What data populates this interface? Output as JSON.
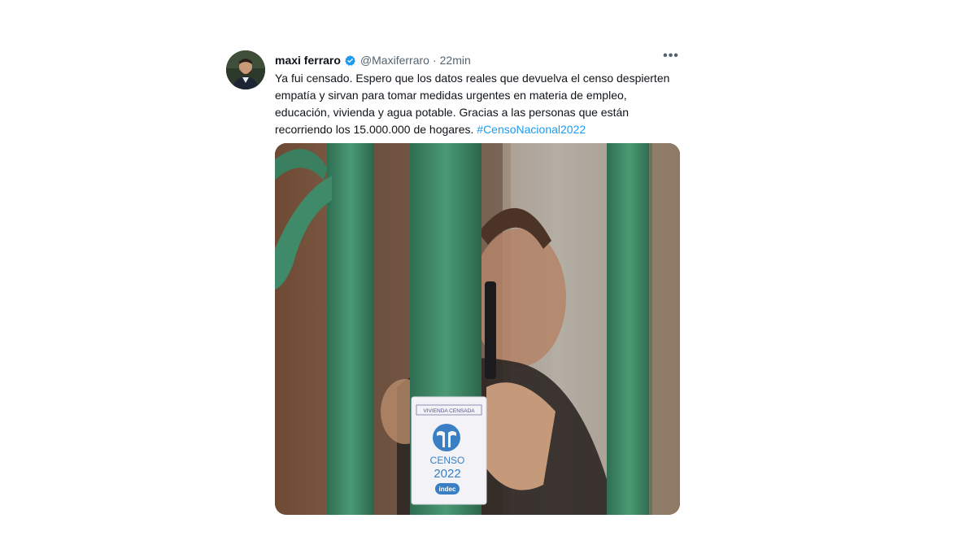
{
  "tweet": {
    "author_name": "maxi ferraro",
    "handle": "@Maxiferraro",
    "separator": "·",
    "time": "22min",
    "more_label": "•••",
    "text": "Ya fui censado. Espero que los datos reales que devuelva el censo despierten empatía y sirvan para tomar medidas urgentes en materia de empleo, educación, vivienda y agua potable. Gracias a las personas que están recorriendo los 15.000.000 de hogares. ",
    "hashtag": "#CensoNacional2022"
  },
  "media": {
    "sticker_top": "VIVIENDA CENSADA",
    "sticker_word": "CENSO",
    "sticker_year": "2022",
    "sticker_brand": "indec"
  },
  "colors": {
    "verified": "#1d9bf0",
    "hashtag": "#1d9bf0",
    "gate_green": "#3f8a68",
    "sticker_blue": "#3a7fc4"
  },
  "icons": [
    "verified-badge-icon",
    "more-options-icon",
    "censo-logo-icon"
  ]
}
